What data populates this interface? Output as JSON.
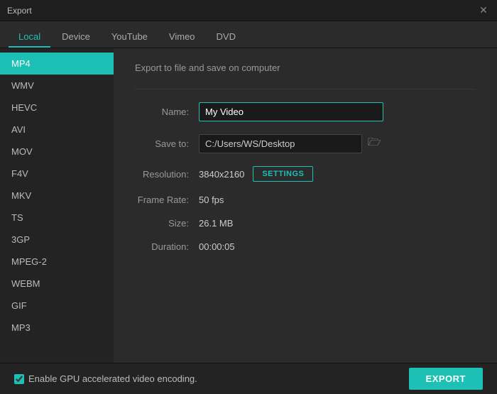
{
  "titleBar": {
    "title": "Export",
    "closeIcon": "✕"
  },
  "tabs": [
    {
      "id": "local",
      "label": "Local",
      "active": true
    },
    {
      "id": "device",
      "label": "Device",
      "active": false
    },
    {
      "id": "youtube",
      "label": "YouTube",
      "active": false
    },
    {
      "id": "vimeo",
      "label": "Vimeo",
      "active": false
    },
    {
      "id": "dvd",
      "label": "DVD",
      "active": false
    }
  ],
  "sidebar": {
    "items": [
      {
        "id": "mp4",
        "label": "MP4",
        "active": true
      },
      {
        "id": "wmv",
        "label": "WMV",
        "active": false
      },
      {
        "id": "hevc",
        "label": "HEVC",
        "active": false
      },
      {
        "id": "avi",
        "label": "AVI",
        "active": false
      },
      {
        "id": "mov",
        "label": "MOV",
        "active": false
      },
      {
        "id": "f4v",
        "label": "F4V",
        "active": false
      },
      {
        "id": "mkv",
        "label": "MKV",
        "active": false
      },
      {
        "id": "ts",
        "label": "TS",
        "active": false
      },
      {
        "id": "3gp",
        "label": "3GP",
        "active": false
      },
      {
        "id": "mpeg2",
        "label": "MPEG-2",
        "active": false
      },
      {
        "id": "webm",
        "label": "WEBM",
        "active": false
      },
      {
        "id": "gif",
        "label": "GIF",
        "active": false
      },
      {
        "id": "mp3",
        "label": "MP3",
        "active": false
      }
    ]
  },
  "panel": {
    "title": "Export to file and save on computer",
    "nameLabel": "Name:",
    "nameValue": "My Video",
    "saveToLabel": "Save to:",
    "saveToValue": "C:/Users/WS/Desktop",
    "folderIcon": "🗁",
    "resolutionLabel": "Resolution:",
    "resolutionValue": "3840x2160",
    "settingsLabel": "SETTINGS",
    "frameRateLabel": "Frame Rate:",
    "frameRateValue": "50 fps",
    "sizeLabel": "Size:",
    "sizeValue": "26.1 MB",
    "durationLabel": "Duration:",
    "durationValue": "00:00:05"
  },
  "bottomBar": {
    "gpuLabel": "Enable GPU accelerated video encoding.",
    "gpuChecked": true,
    "exportLabel": "EXPORT"
  }
}
